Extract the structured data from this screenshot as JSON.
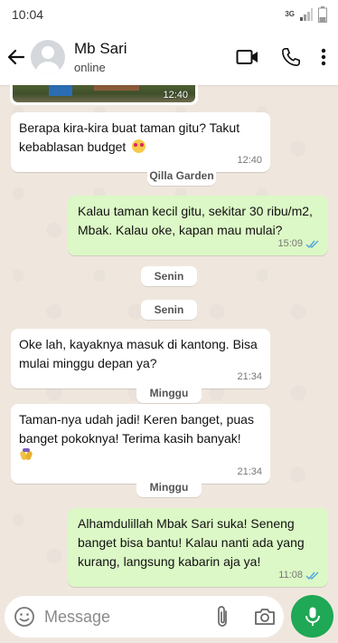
{
  "status_bar": {
    "time": "10:04",
    "network": "3G"
  },
  "header": {
    "contact_name": "Mb Sari",
    "contact_status": "online"
  },
  "messages": [
    {
      "type": "image",
      "time": "12:40"
    },
    {
      "type": "in",
      "text": "Berapa kira-kira buat taman gitu? Takut kebablasan budget",
      "time": "12:40"
    },
    {
      "type": "label",
      "text": "Qilla Garden"
    },
    {
      "type": "out",
      "text": "Kalau taman kecil gitu, sekitar 30 ribu/m2, Mbak. Kalau oke, kapan mau mulai?",
      "time": "15:09"
    },
    {
      "type": "date",
      "text": "Senin"
    },
    {
      "type": "date",
      "text": "Senin"
    },
    {
      "type": "in",
      "text": "Oke lah, kayaknya masuk di kantong. Bisa mulai minggu depan ya?",
      "time": "21:34"
    },
    {
      "type": "date",
      "text": "Minggu"
    },
    {
      "type": "in",
      "text": "Taman-nya udah jadi! Keren banget, puas banget pokoknya! Terima kasih banyak!",
      "time": "21:34"
    },
    {
      "type": "date",
      "text": "Minggu"
    },
    {
      "type": "out",
      "text": "Alhamdulillah Mbak Sari suka! Seneng banget bisa bantu! Kalau nanti ada yang kurang, langsung kabarin aja ya!",
      "time": "11:08"
    }
  ],
  "composer": {
    "placeholder": "Message"
  },
  "colors": {
    "outgoing": "#dcf8c6",
    "incoming": "#ffffff",
    "accent": "#1fa855",
    "read_ticks": "#4fa3e0"
  }
}
